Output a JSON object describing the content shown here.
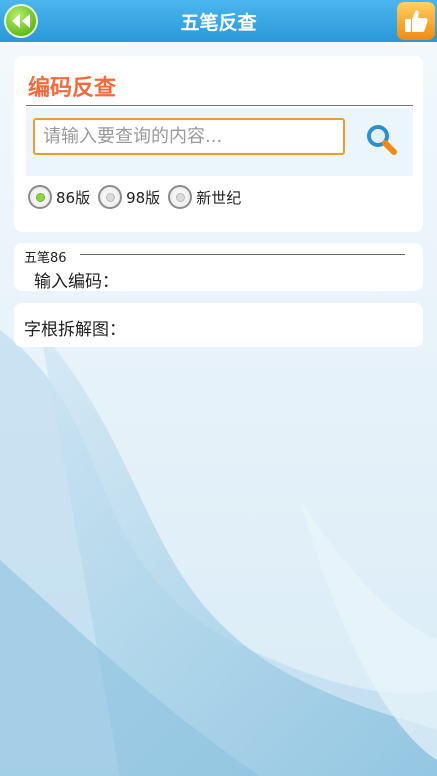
{
  "header": {
    "title": "五笔反查",
    "back_icon": "double-left-arrow-icon",
    "like_icon": "thumbs-up-icon"
  },
  "search": {
    "section_title": "编码反查",
    "placeholder": "请输入要查询的内容...",
    "value": "",
    "search_icon": "magnifier-icon"
  },
  "versions": {
    "options": [
      {
        "label": "86版",
        "selected": true
      },
      {
        "label": "98版",
        "selected": false
      },
      {
        "label": "新世纪",
        "selected": false
      }
    ]
  },
  "result": {
    "legend": "五笔86",
    "code_label": "输入编码："
  },
  "decomposition": {
    "label": "字根拆解图："
  }
}
